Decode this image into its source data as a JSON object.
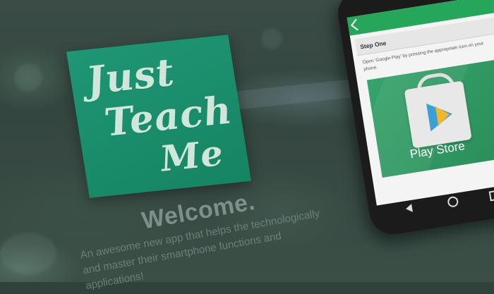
{
  "logo": {
    "line1": "Just",
    "line2": "Teach",
    "line3": "Me"
  },
  "welcome": {
    "heading": "Welcome.",
    "tagline_line1": "An awesome new app that helps the technologically",
    "tagline_line2": "and master their smartphone functions and",
    "tagline_line3": "applications!"
  },
  "phone": {
    "step_title": "Step One",
    "step_instruction": "Open 'Google Play' by pressing the appropriate icon on your phone.",
    "store_label": "Play Store",
    "icons": {
      "back": "back-arrow-icon",
      "bag": "shopping-bag-icon",
      "play": "play-triangle-icon",
      "nav_back": "nav-back-icon",
      "nav_home": "nav-home-icon",
      "nav_recent": "nav-recent-icon"
    },
    "colors": {
      "accent_green": "#26a65b"
    }
  },
  "brand_colors": {
    "logo_green": "#1f9675"
  }
}
